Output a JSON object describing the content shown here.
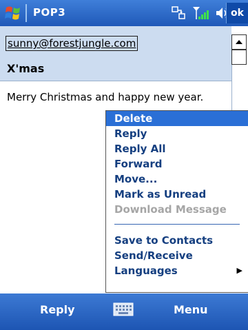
{
  "titlebar": {
    "start_icon": "windows-flag-icon",
    "title": "POP3",
    "ok_label": "ok",
    "status_icons": [
      "connectivity-icon",
      "signal-icon",
      "volume-icon"
    ]
  },
  "message": {
    "sender": "sunny@forestjungle.com",
    "subject": "X'mas",
    "body": "Merry Christmas and happy new year."
  },
  "context_menu": {
    "items": [
      {
        "label": "Delete",
        "state": "selected"
      },
      {
        "label": "Reply"
      },
      {
        "label": "Reply All"
      },
      {
        "label": "Forward"
      },
      {
        "label": "Move..."
      },
      {
        "label": "Mark as Unread"
      },
      {
        "label": "Download Message",
        "state": "disabled"
      },
      {
        "label": "Save to Contacts"
      },
      {
        "label": "Send/Receive"
      },
      {
        "label": "Languages",
        "submenu": true
      }
    ]
  },
  "softkeys": {
    "left": "Reply",
    "center_icon": "keyboard-icon",
    "right": "Menu"
  },
  "colors": {
    "title_bar": "#1f59b8",
    "header_bg": "#ccdcf0",
    "menu_selected": "#2a6fd6",
    "menu_text": "#153f80",
    "menu_disabled": "#a6a6a6"
  }
}
